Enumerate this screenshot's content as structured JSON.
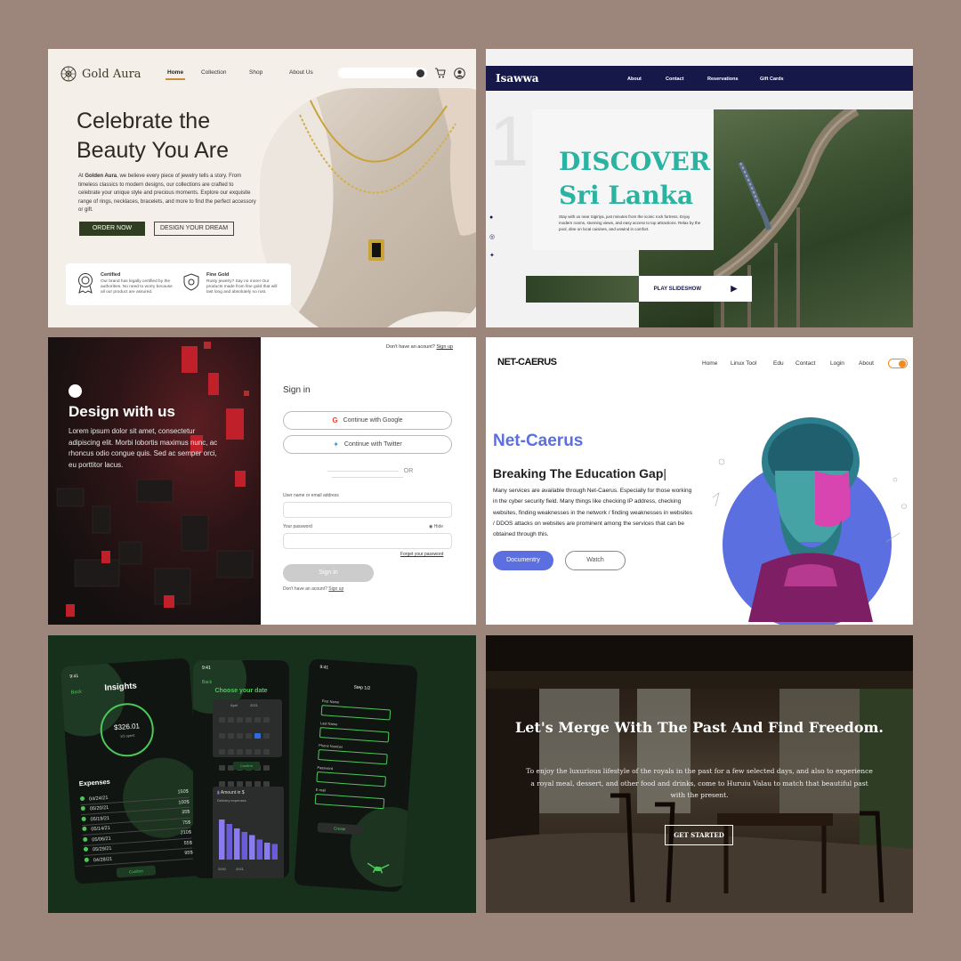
{
  "gold_aura": {
    "brand": "Gold Aura",
    "nav": [
      "Home",
      "Collection",
      "Shop",
      "About Us"
    ],
    "headline_1": "Celebrate the",
    "headline_2": "Beauty You Are",
    "desc_prefix": "At ",
    "desc_brand": "Golden Aura",
    "desc_rest": ", we believe every piece of jewelry tells a story. From timeless classics to modern designs, our collections are crafted to celebrate your unique style and precious moments. Explore our exquisite range of rings, necklaces, bracelets, and more to find the perfect accessory or gift.",
    "order_now": "ORDER NOW",
    "design_dream": "DESIGN YOUR DREAM",
    "certified_title": "Certified",
    "certified_desc": "Our brand has legally certified by the authorities. No need to worry because all our product are assured.",
    "fine_gold_title": "Fine Gold",
    "fine_gold_desc": "Rusty jewelry? Say no more! Our products made from fine gold that will last long and absolutely no rust."
  },
  "isawwa": {
    "brand": "Isawwa",
    "nav": [
      "About",
      "Contact",
      "Reservations",
      "Gift Cards"
    ],
    "number": "1",
    "title_1": "DISCOVER",
    "title_2": "Sri Lanka",
    "desc": "Stay with us near Sigiriya, just minutes from the iconic rock fortress. Enjoy modern rooms, stunning views, and easy access to top attractions. Relax by the pool, dine on local cuisines, and unwind in comfort.",
    "play": "PLAY SLIDESHOW"
  },
  "design_login": {
    "headline": "Design with us",
    "lorem": "Lorem ipsum dolor sit amet, consectetur adipiscing elit. Morbi lobortis maximus nunc, ac rhoncus odio congue quis. Sed ac semper orci, eu porttitor lacus.",
    "top_prompt": "Don't have an acount? ",
    "sign_up": "Sign up",
    "sign_in_title": "Sign in",
    "google": "Continue with Google",
    "twitter": "Continue with Twitter",
    "or": "OR",
    "user_label": "User name or email address",
    "password_label": "Your password",
    "hide": "Hide",
    "forget": "Forget your password",
    "sign_in_btn": "Sign in",
    "bottom_prompt": "Don't have an acount? "
  },
  "net_caerus": {
    "logo": "NET-CAERUS",
    "nav": [
      "Home",
      "Linux Tool",
      "Edu",
      "Contact",
      "Login",
      "About"
    ],
    "title": "Net-Caerus",
    "subtitle": "Breaking The Education Gap",
    "desc": "Many services are available through Net-Caerus. Especially for those working in the cyber security field. Many things like checking IP address, checking websites, finding weaknesses in the network / finding weaknesses in websites / DDOS attacks on websites are prominent among the services that can be obtained through this.",
    "doc_btn": "Documentry",
    "watch_btn": "Watch"
  },
  "finance_app": {
    "phone1": {
      "time": "9:41",
      "back": "Back",
      "title": "Insights",
      "amount": "$326.01",
      "amount_sub": "1/3 spent",
      "expenses_title": "Expenses",
      "expenses": [
        {
          "date": "04/24/21",
          "amount": "150$"
        },
        {
          "date": "05/20/21",
          "amount": "100$"
        },
        {
          "date": "05/19/21",
          "amount": "35$"
        },
        {
          "date": "05/14/21",
          "amount": "75$"
        },
        {
          "date": "05/06/21",
          "amount": "210$"
        },
        {
          "date": "05/29/21",
          "amount": "55$"
        },
        {
          "date": "04/28/21",
          "amount": "95$"
        }
      ],
      "confirm": "Confirm"
    },
    "phone2": {
      "time": "9:41",
      "back": "Back",
      "title": "Choose your date",
      "month": "April",
      "year": "2021",
      "confirm": "Confirm",
      "amount_label": "Amount in $",
      "delivery": "Delivery expenses",
      "bars": [
        0.9,
        0.8,
        0.7,
        0.62,
        0.55,
        0.45,
        0.38,
        0.35
      ],
      "years": [
        "2020",
        "2021"
      ]
    },
    "phone3": {
      "time": "9:41",
      "step": "Step 1/2",
      "fields": [
        "First Name",
        "Last Name",
        "Phone Number",
        "Password",
        "E-mail"
      ],
      "create": "Create"
    }
  },
  "heritage": {
    "title": "Let's Merge With The Past And Find Freedom.",
    "desc": "To enjoy the luxurious lifestyle of the royals in the past for a few selected days, and also to experience a royal meal, dessert, and other food and drinks, come to Huruiu Valau to match that beautiful past with the present.",
    "cta": "GET STARTED"
  },
  "colors": {
    "page_bg": "#9c857a",
    "gold_green": "#2f3d21",
    "isawwa_navy": "#16184a",
    "isawwa_teal": "#2ab3a0",
    "caerus_blue": "#5b6fe0",
    "app_green": "#4cc85a"
  }
}
